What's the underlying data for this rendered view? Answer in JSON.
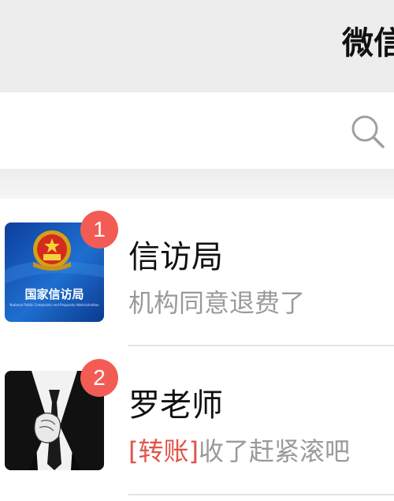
{
  "header": {
    "title": "微信"
  },
  "search": {
    "icon": "search-icon"
  },
  "chats": [
    {
      "name": "信访局",
      "preview": "机构同意退费了",
      "unread": "1",
      "avatar": {
        "icon": "national-emblem-icon",
        "caption": "国家信访局",
        "subcaption": "National Public Complaints and Proposals Administration"
      }
    },
    {
      "name": "罗老师",
      "tag": "[转账]",
      "preview": "收了赶紧滚吧",
      "unread": "2",
      "avatar": {
        "icon": "suit-tie-icon"
      }
    }
  ],
  "colors": {
    "badge": "#f25c54",
    "transfer_tag": "#e0544b",
    "header_bg": "#ededed"
  }
}
